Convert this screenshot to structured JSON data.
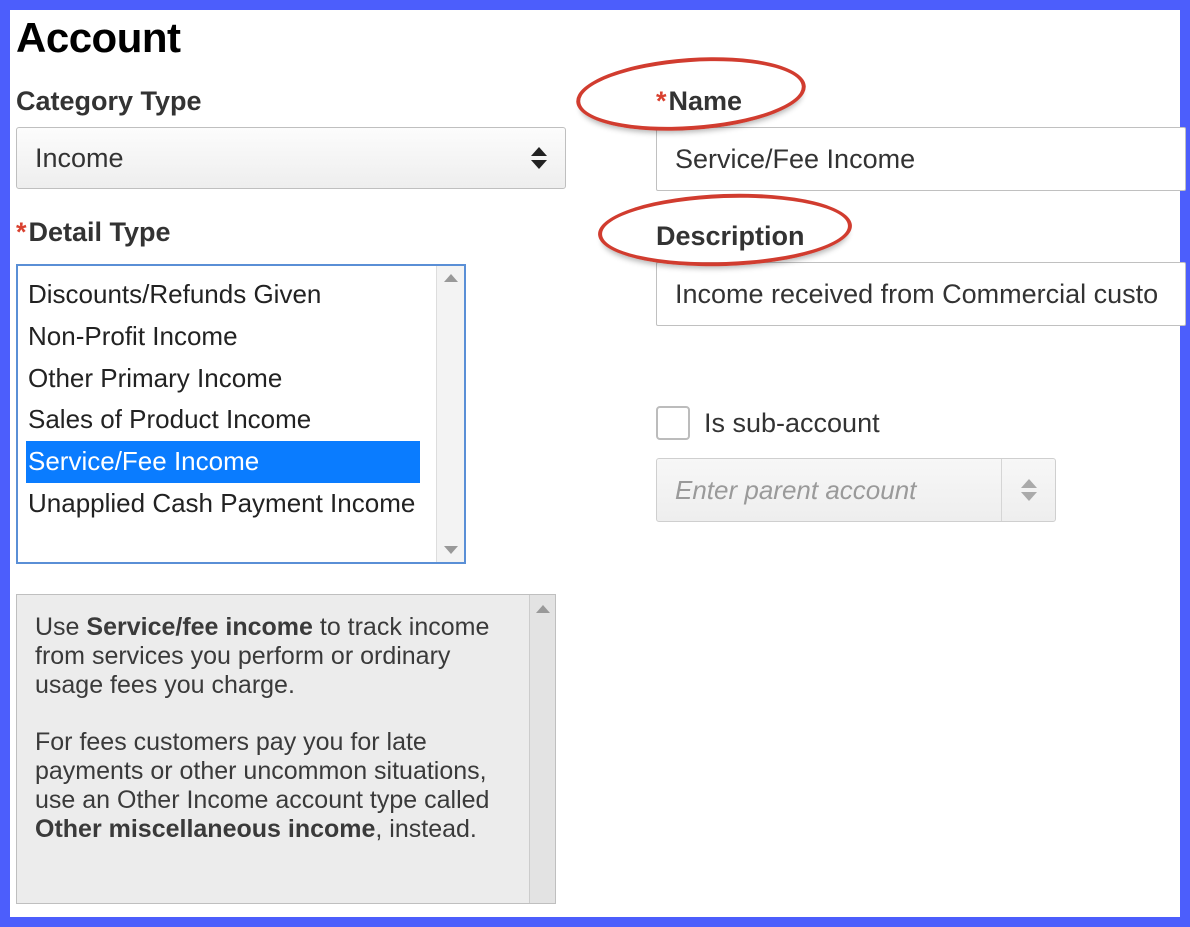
{
  "title": "Account",
  "categoryType": {
    "label": "Category Type",
    "value": "Income"
  },
  "detailType": {
    "label": "Detail Type",
    "options": [
      "Discounts/Refunds Given",
      "Non-Profit Income",
      "Other Primary Income",
      "Sales of Product Income",
      "Service/Fee Income",
      "Unapplied Cash Payment Income"
    ],
    "selected": "Service/Fee Income"
  },
  "info": {
    "p1_pre": "Use ",
    "p1_bold": "Service/fee income",
    "p1_post": " to track income from services you perform or ordinary usage fees you charge.",
    "p2_pre": "For fees customers pay you for late payments or other uncommon situations, use an Other Income account type called ",
    "p2_bold": "Other miscellaneous income",
    "p2_post": ", instead."
  },
  "name": {
    "label": "Name",
    "value": "Service/Fee Income"
  },
  "description": {
    "label": "Description",
    "value": "Income received from Commercial custo"
  },
  "subAccount": {
    "label": "Is sub-account",
    "checked": false,
    "parentPlaceholder": "Enter parent account"
  }
}
